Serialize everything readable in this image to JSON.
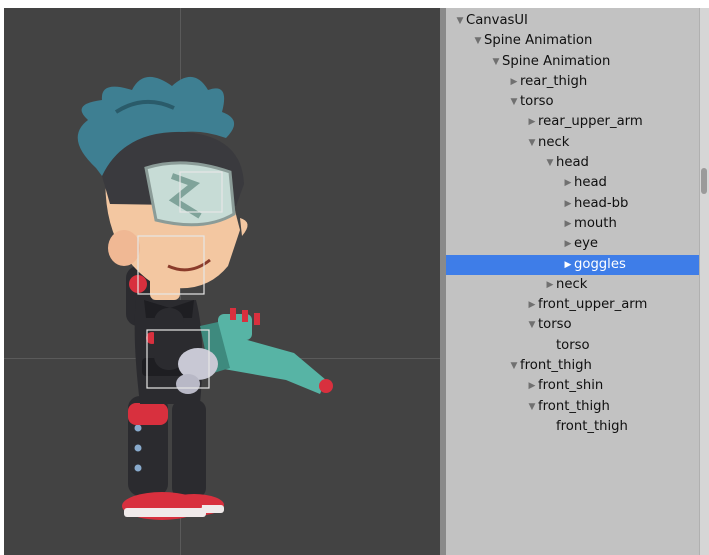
{
  "hierarchy": {
    "items": [
      {
        "label": "CanvasUI",
        "depth": 0,
        "state": "expanded"
      },
      {
        "label": "Spine Animation",
        "depth": 1,
        "state": "expanded"
      },
      {
        "label": "Spine Animation",
        "depth": 2,
        "state": "expanded"
      },
      {
        "label": "rear_thigh",
        "depth": 3,
        "state": "collapsed"
      },
      {
        "label": "torso",
        "depth": 3,
        "state": "expanded"
      },
      {
        "label": "rear_upper_arm",
        "depth": 4,
        "state": "collapsed"
      },
      {
        "label": "neck",
        "depth": 4,
        "state": "expanded"
      },
      {
        "label": "head",
        "depth": 5,
        "state": "expanded"
      },
      {
        "label": "head",
        "depth": 6,
        "state": "collapsed"
      },
      {
        "label": "head-bb",
        "depth": 6,
        "state": "collapsed"
      },
      {
        "label": "mouth",
        "depth": 6,
        "state": "collapsed"
      },
      {
        "label": "eye",
        "depth": 6,
        "state": "collapsed"
      },
      {
        "label": "goggles",
        "depth": 6,
        "state": "collapsed",
        "selected": true
      },
      {
        "label": "neck",
        "depth": 5,
        "state": "collapsed"
      },
      {
        "label": "front_upper_arm",
        "depth": 4,
        "state": "collapsed"
      },
      {
        "label": "torso",
        "depth": 4,
        "state": "expanded"
      },
      {
        "label": "torso",
        "depth": 5,
        "state": "leaf"
      },
      {
        "label": "front_thigh",
        "depth": 3,
        "state": "expanded"
      },
      {
        "label": "front_shin",
        "depth": 4,
        "state": "collapsed"
      },
      {
        "label": "front_thigh",
        "depth": 4,
        "state": "expanded"
      },
      {
        "label": "front_thigh",
        "depth": 5,
        "state": "leaf"
      }
    ]
  },
  "colors": {
    "scene_bg": "#434343",
    "panel_bg": "#c2c2c2",
    "selection": "#3e7de8",
    "hair": "#3e7f92",
    "goggles": "#c7dcd6",
    "skin": "#f3c7a1",
    "suit": "#2b2b2f",
    "boot_red": "#d8303e",
    "gun_teal": "#57b4a5"
  },
  "icons": {
    "expanded": "triangle-down-icon",
    "collapsed": "triangle-right-icon"
  }
}
